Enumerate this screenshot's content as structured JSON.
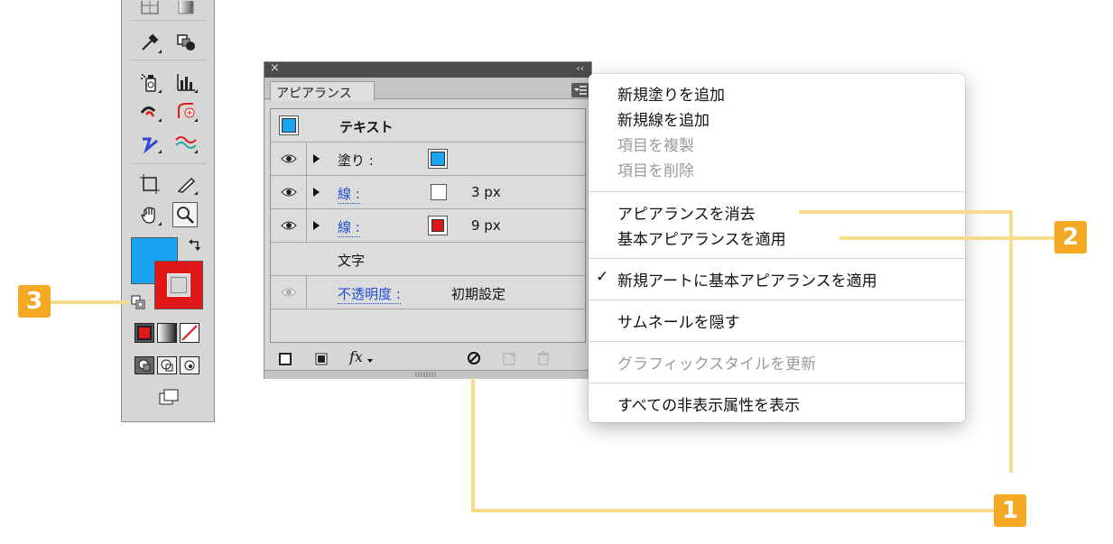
{
  "toolbar": {
    "fill_color": "#1aa3f0",
    "stroke_color": "#e01818"
  },
  "panel": {
    "close_glyph": "×",
    "collapse_glyph": "‹‹",
    "tab_label": "アピアランス",
    "target_label": "テキスト",
    "rows": [
      {
        "label": "塗り :",
        "kind": "fill",
        "swatch_color": "#1aa3f0",
        "value": ""
      },
      {
        "label": "線 :",
        "kind": "stroke",
        "swatch_color": "#ffffff",
        "value": "3 px"
      },
      {
        "label": "線 :",
        "kind": "stroke",
        "swatch_color": "#e01818",
        "value": "9 px"
      },
      {
        "label": "文字",
        "kind": "characters",
        "value": ""
      },
      {
        "label": "不透明度 :",
        "kind": "opacity",
        "value": "初期設定"
      }
    ],
    "footer_fx_label": "fx"
  },
  "menu": {
    "items": [
      {
        "label": "新規塗りを追加",
        "enabled": true
      },
      {
        "label": "新規線を追加",
        "enabled": true
      },
      {
        "label": "項目を複製",
        "enabled": false
      },
      {
        "label": "項目を削除",
        "enabled": false
      },
      {
        "label": "アピアランスを消去",
        "enabled": true
      },
      {
        "label": "基本アピアランスを適用",
        "enabled": true
      },
      {
        "label": "新規アートに基本アピアランスを適用",
        "enabled": true,
        "checked": true
      },
      {
        "label": "サムネールを隠す",
        "enabled": true
      },
      {
        "label": "グラフィックスタイルを更新",
        "enabled": false
      },
      {
        "label": "すべての非表示属性を表示",
        "enabled": true
      }
    ],
    "check_glyph": "✓"
  },
  "callouts": {
    "badge_1": "1",
    "badge_2": "2",
    "badge_3": "3",
    "line_color": "#f9d98a",
    "badge_color": "#f4a823"
  }
}
